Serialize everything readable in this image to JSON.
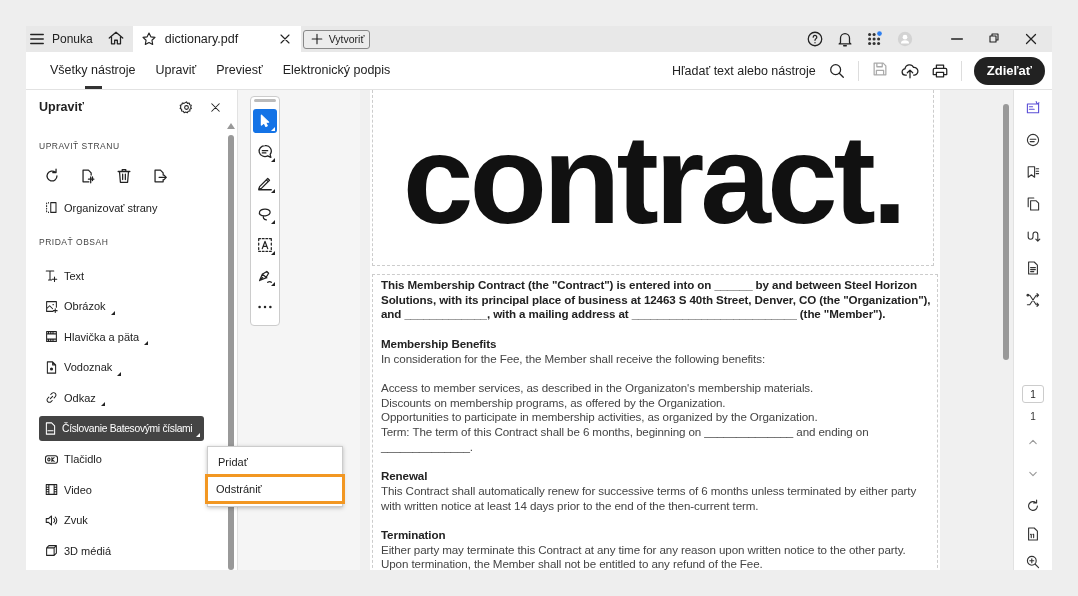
{
  "title_bar": {
    "menu_label": "Ponuka",
    "tabs": [
      {
        "title": "dictionary.pdf",
        "selected": true
      }
    ],
    "create_button": "Vytvoriť"
  },
  "toolbar": {
    "tabs": [
      {
        "label": "Všetky nástroje",
        "selected": true
      },
      {
        "label": "Upraviť",
        "selected": false
      },
      {
        "label": "Previesť",
        "selected": false
      },
      {
        "label": "Elektronický podpis",
        "selected": false
      }
    ],
    "search_label": "Hľadať text alebo nástroje",
    "save_disabled": true,
    "share_button": "Zdieľať"
  },
  "panel": {
    "title": "Upraviť",
    "sections": [
      {
        "kind": "page",
        "heading": "UPRAVIŤ STRANU",
        "items": [
          {
            "label": "Organizovať strany",
            "has_submenu": false,
            "selected": false
          }
        ]
      },
      {
        "kind": "content",
        "heading": "PRIDAŤ OBSAH",
        "items": [
          {
            "label": "Text",
            "has_submenu": false,
            "selected": false
          },
          {
            "label": "Obrázok",
            "has_submenu": true,
            "selected": false
          },
          {
            "label": "Hlavička a päta",
            "has_submenu": true,
            "selected": false
          },
          {
            "label": "Vodoznak",
            "has_submenu": true,
            "selected": false
          },
          {
            "label": "Odkaz",
            "has_submenu": true,
            "selected": false
          },
          {
            "label": "Číslovanie Batesovými číslami",
            "has_submenu": true,
            "selected": true
          },
          {
            "label": "Tlačidlo",
            "has_submenu": false,
            "selected": false
          },
          {
            "label": "Video",
            "has_submenu": false,
            "selected": false
          },
          {
            "label": "Zvuk",
            "has_submenu": false,
            "selected": false
          },
          {
            "label": "3D médiá",
            "has_submenu": false,
            "selected": false
          }
        ]
      }
    ]
  },
  "context_menu": {
    "items": [
      {
        "label": "Pridať",
        "selected": false
      },
      {
        "label": "Odstrániť",
        "selected": true
      }
    ]
  },
  "tool_palette": {
    "tools": [
      {
        "selected": true
      },
      {
        "selected": false
      },
      {
        "selected": false
      },
      {
        "selected": false
      },
      {
        "selected": false
      },
      {
        "selected": false
      }
    ]
  },
  "document": {
    "title": "contract.",
    "intro": "This Membership Contract (the \"Contract\") is entered into on ______ by and between Steel Horizon Solutions, with its principal place of business at 12463 S 40th Street, Denver, CO (the \"Organization\"), and _____________, with a mailing address at __________________________ (the \"Member\").",
    "sections": [
      {
        "heading": "Membership Benefits",
        "groups": [
          [
            "In consideration for the Fee, the Member shall receive the following benefits:"
          ],
          [
            "Access to member services, as described in the Organizaton's membership materials.",
            "Discounts on membership programs, as offered by the Organization.",
            "Opportunities to participate in membership activities, as organized by the Organization.",
            "Term: The term of this Contract shall be 6 months, beginning on ______________ and ending on ______________."
          ]
        ]
      },
      {
        "heading": "Renewal",
        "groups": [
          [
            "This Contract shall automatically renew for successive terms of 6 months unless terminated by either party with written notice at least 14 days prior to the end of the then-current term."
          ]
        ]
      },
      {
        "heading": "Termination",
        "groups": [
          [
            "Either party may terminate this Contract at any time for any reason upon written notice to the other party. Upon termination, the Member shall not be entitled to any refund of the Fee."
          ]
        ]
      }
    ]
  },
  "right_rail": {
    "tools": [
      {
        "selected": true
      },
      {
        "selected": false
      },
      {
        "selected": false
      },
      {
        "selected": false
      },
      {
        "selected": false
      },
      {
        "selected": false
      },
      {
        "selected": false
      }
    ],
    "page_input": "1",
    "page_count": "1"
  }
}
